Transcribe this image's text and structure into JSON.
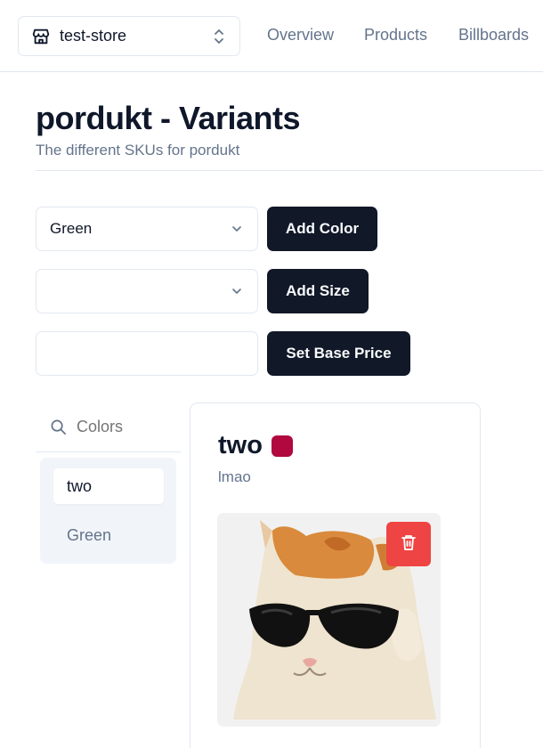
{
  "nav": {
    "store_name": "test-store",
    "links": [
      "Overview",
      "Products",
      "Billboards"
    ]
  },
  "header": {
    "title": "pordukt - Variants",
    "subtitle": "The different SKUs for pordukt"
  },
  "form": {
    "color_select_value": "Green",
    "add_color_label": "Add Color",
    "size_select_value": "",
    "add_size_label": "Add Size",
    "base_price_value": "",
    "set_base_price_label": "Set Base Price"
  },
  "colors": {
    "search_placeholder": "Colors",
    "items": [
      "two",
      "Green"
    ],
    "selected": "two"
  },
  "variant": {
    "name": "two",
    "description": "lmao",
    "swatch_color": "#b0083f",
    "image_icon": "cat-with-sunglasses-image",
    "delete_icon": "trash-icon"
  },
  "theme": {
    "primary_button": "#111827",
    "danger": "#ef4444",
    "muted_text": "#64748b",
    "border": "#e2e8f0"
  }
}
